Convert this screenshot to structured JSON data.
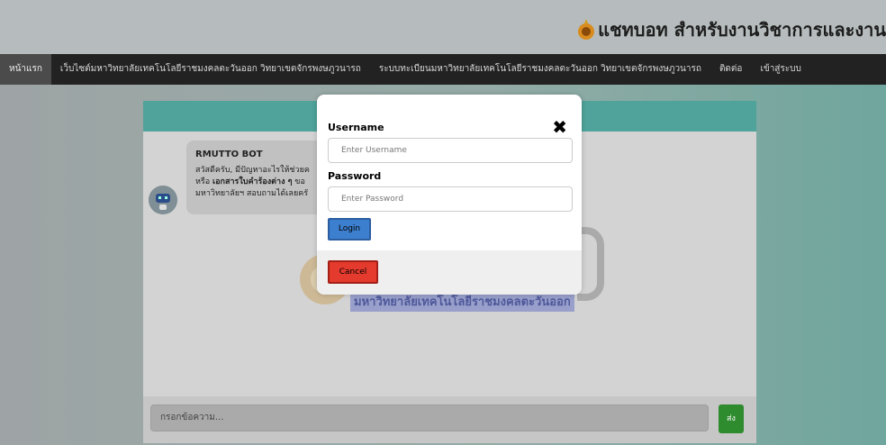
{
  "header": {
    "title": "แชทบอท สำหรับงานวิชาการและงาน"
  },
  "nav": {
    "items": [
      "หน้าแรก",
      "เว็บไซต์มหาวิทยาลัยเทคโนโลยีราชมงคลตะวันออก วิทยาเขตจักรพงษภูวนารถ",
      "ระบบทะเบียนมหาวิทยาลัยเทคโนโลยีราชมงคลตะวันออก วิทยาเขตจักรพงษภูวนารถ",
      "ติดต่อ",
      "เข้าสู่ระบบ"
    ]
  },
  "chat": {
    "bot_name": "RMUTTO BOT",
    "message_line1": "สวัสดีครับ, มีปัญหาอะไรให้ช่วยค",
    "message_line2_pre": "หรือ ",
    "message_line2_bold": "เอกสารใบคำร้องต่าง ๆ",
    "message_line2_post": " ขอ",
    "message_line3": "มหาวิทยาลัยฯ สอบถามได้เลยครั",
    "watermark_text": "มหาวิทยาลัยเทคโนโลยีราชมงคลตะวันออก",
    "input_placeholder": "กรอกข้อความ...",
    "send_label": "ส่ง"
  },
  "modal": {
    "username_label": "Username",
    "username_placeholder": "Enter Username",
    "password_label": "Password",
    "password_placeholder": "Enter Password",
    "login_label": "Login",
    "cancel_label": "Cancel",
    "close_icon": "close-icon"
  },
  "colors": {
    "nav_bg": "#222222",
    "chat_header": "#4fa39a",
    "login": "#3d7fcf",
    "cancel": "#e53a2e",
    "send": "#2e8b2e"
  }
}
